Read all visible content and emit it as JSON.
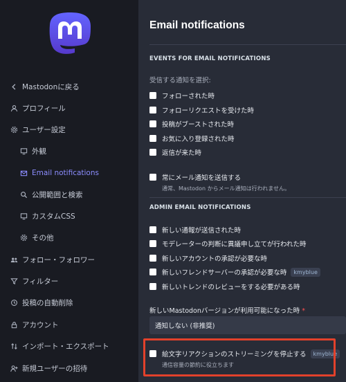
{
  "sidebar": {
    "items": [
      {
        "label": "Mastodonに戻る",
        "icon": "chevron-left-icon",
        "name": "sidebar-item-back"
      },
      {
        "label": "プロフィール",
        "icon": "user-icon",
        "name": "sidebar-item-profile"
      },
      {
        "label": "ユーザー設定",
        "icon": "gear-icon",
        "name": "sidebar-item-preferences"
      },
      {
        "label": "外観",
        "icon": "monitor-icon",
        "name": "sidebar-item-appearance"
      },
      {
        "label": "Email notifications",
        "icon": "envelope-icon",
        "name": "sidebar-item-email-notifications",
        "active": true
      },
      {
        "label": "公開範囲と検索",
        "icon": "search-icon",
        "name": "sidebar-item-privacy"
      },
      {
        "label": "カスタムCSS",
        "icon": "monitor-icon",
        "name": "sidebar-item-custom-css"
      },
      {
        "label": "その他",
        "icon": "gear-icon",
        "name": "sidebar-item-other"
      },
      {
        "label": "フォロー・フォロワー",
        "icon": "users-icon",
        "name": "sidebar-item-relationships"
      },
      {
        "label": "フィルター",
        "icon": "filter-icon",
        "name": "sidebar-item-filters"
      },
      {
        "label": "投稿の自動削除",
        "icon": "history-icon",
        "name": "sidebar-item-auto-delete"
      },
      {
        "label": "アカウント",
        "icon": "lock-icon",
        "name": "sidebar-item-account"
      },
      {
        "label": "インポート・エクスポート",
        "icon": "import-export-icon",
        "name": "sidebar-item-import-export"
      },
      {
        "label": "新規ユーザーの招待",
        "icon": "user-plus-icon",
        "name": "sidebar-item-invites"
      }
    ]
  },
  "main": {
    "title": "Email notifications",
    "events_section": {
      "heading": "EVENTS FOR EMAIL NOTIFICATIONS",
      "hint": "受信する通知を選択:",
      "options": [
        {
          "label": "フォローされた時",
          "checked": false
        },
        {
          "label": "フォローリクエストを受けた時",
          "checked": false
        },
        {
          "label": "投稿がブーストされた時",
          "checked": false
        },
        {
          "label": "お気に入り登録された時",
          "checked": false
        },
        {
          "label": "返信が来た時",
          "checked": false
        }
      ],
      "always_send": {
        "label": "常にメール通知を送信する",
        "hint": "通常、Mastodon からメール通知は行われません。",
        "checked": false
      }
    },
    "admin_section": {
      "heading": "ADMIN EMAIL NOTIFICATIONS",
      "options": [
        {
          "label": "新しい通報が送信された時",
          "checked": false,
          "badge": ""
        },
        {
          "label": "モデレーターの判断に異議申し立てが行われた時",
          "checked": false,
          "badge": ""
        },
        {
          "label": "新しいアカウントの承認が必要な時",
          "checked": false,
          "badge": ""
        },
        {
          "label": "新しいフレンドサーバーの承認が必要な時",
          "checked": false,
          "badge": "kmyblue"
        },
        {
          "label": "新しいトレンドのレビューをする必要がある時",
          "checked": false,
          "badge": ""
        }
      ]
    },
    "version_select": {
      "label": "新しいMastodonバージョンが利用可能になった時",
      "required_mark": "*",
      "value": "通知しない (非推奨)"
    },
    "emoji_streaming": {
      "label": "絵文字リアクションのストリーミングを停止する",
      "badge": "kmyblue",
      "hint": "通信容量の節約に役立ちます",
      "checked": false
    }
  },
  "colors": {
    "accent": "#8c8dff",
    "highlight": "#e3412b",
    "sidebar_bg": "#191b22",
    "main_bg": "#282c37"
  }
}
